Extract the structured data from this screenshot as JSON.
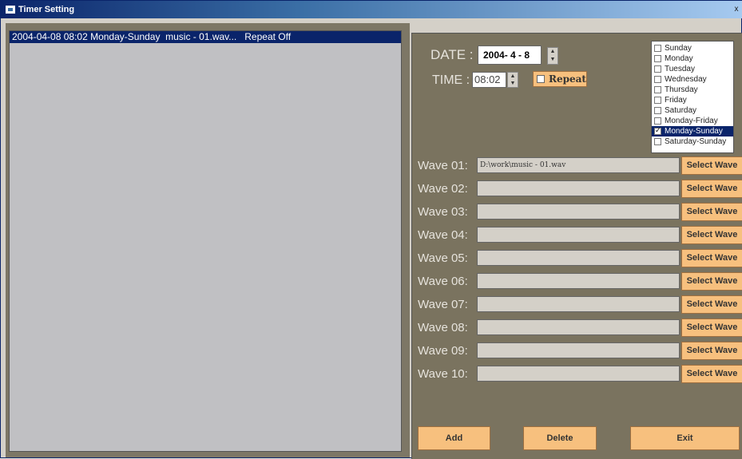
{
  "window": {
    "title": "Timer Setting",
    "close_glyph": "x"
  },
  "list": {
    "entries": [
      "2004-04-08 08:02 Monday-Sunday  music - 01.wav...   Repeat Off"
    ]
  },
  "settings": {
    "date_label": "DATE :",
    "date_value": "2004- 4 - 8",
    "time_label": "TIME :",
    "time_value": "08:02",
    "repeat_label": "Repeat",
    "repeat_checked": false
  },
  "days": [
    {
      "label": "Sunday",
      "checked": false
    },
    {
      "label": "Monday",
      "checked": false
    },
    {
      "label": "Tuesday",
      "checked": false
    },
    {
      "label": "Wednesday",
      "checked": false
    },
    {
      "label": "Thursday",
      "checked": false
    },
    {
      "label": "Friday",
      "checked": false
    },
    {
      "label": "Saturday",
      "checked": false
    },
    {
      "label": "Monday-Friday",
      "checked": false
    },
    {
      "label": "Monday-Sunday",
      "checked": true
    },
    {
      "label": "Saturday-Sunday",
      "checked": false
    }
  ],
  "waves": [
    {
      "label": "Wave 01:",
      "path": "D:\\work\\music - 01.wav"
    },
    {
      "label": "Wave 02:",
      "path": ""
    },
    {
      "label": "Wave 03:",
      "path": ""
    },
    {
      "label": "Wave 04:",
      "path": ""
    },
    {
      "label": "Wave 05:",
      "path": ""
    },
    {
      "label": "Wave 06:",
      "path": ""
    },
    {
      "label": "Wave 07:",
      "path": ""
    },
    {
      "label": "Wave 08:",
      "path": ""
    },
    {
      "label": "Wave 09:",
      "path": ""
    },
    {
      "label": "Wave 10:",
      "path": ""
    }
  ],
  "select_wave_label": "Select Wave",
  "buttons": {
    "add": "Add",
    "delete": "Delete",
    "exit": "Exit"
  },
  "colors": {
    "button_face": "#f7c07e",
    "selection": "#0a246a",
    "panel": "#7a735f"
  }
}
